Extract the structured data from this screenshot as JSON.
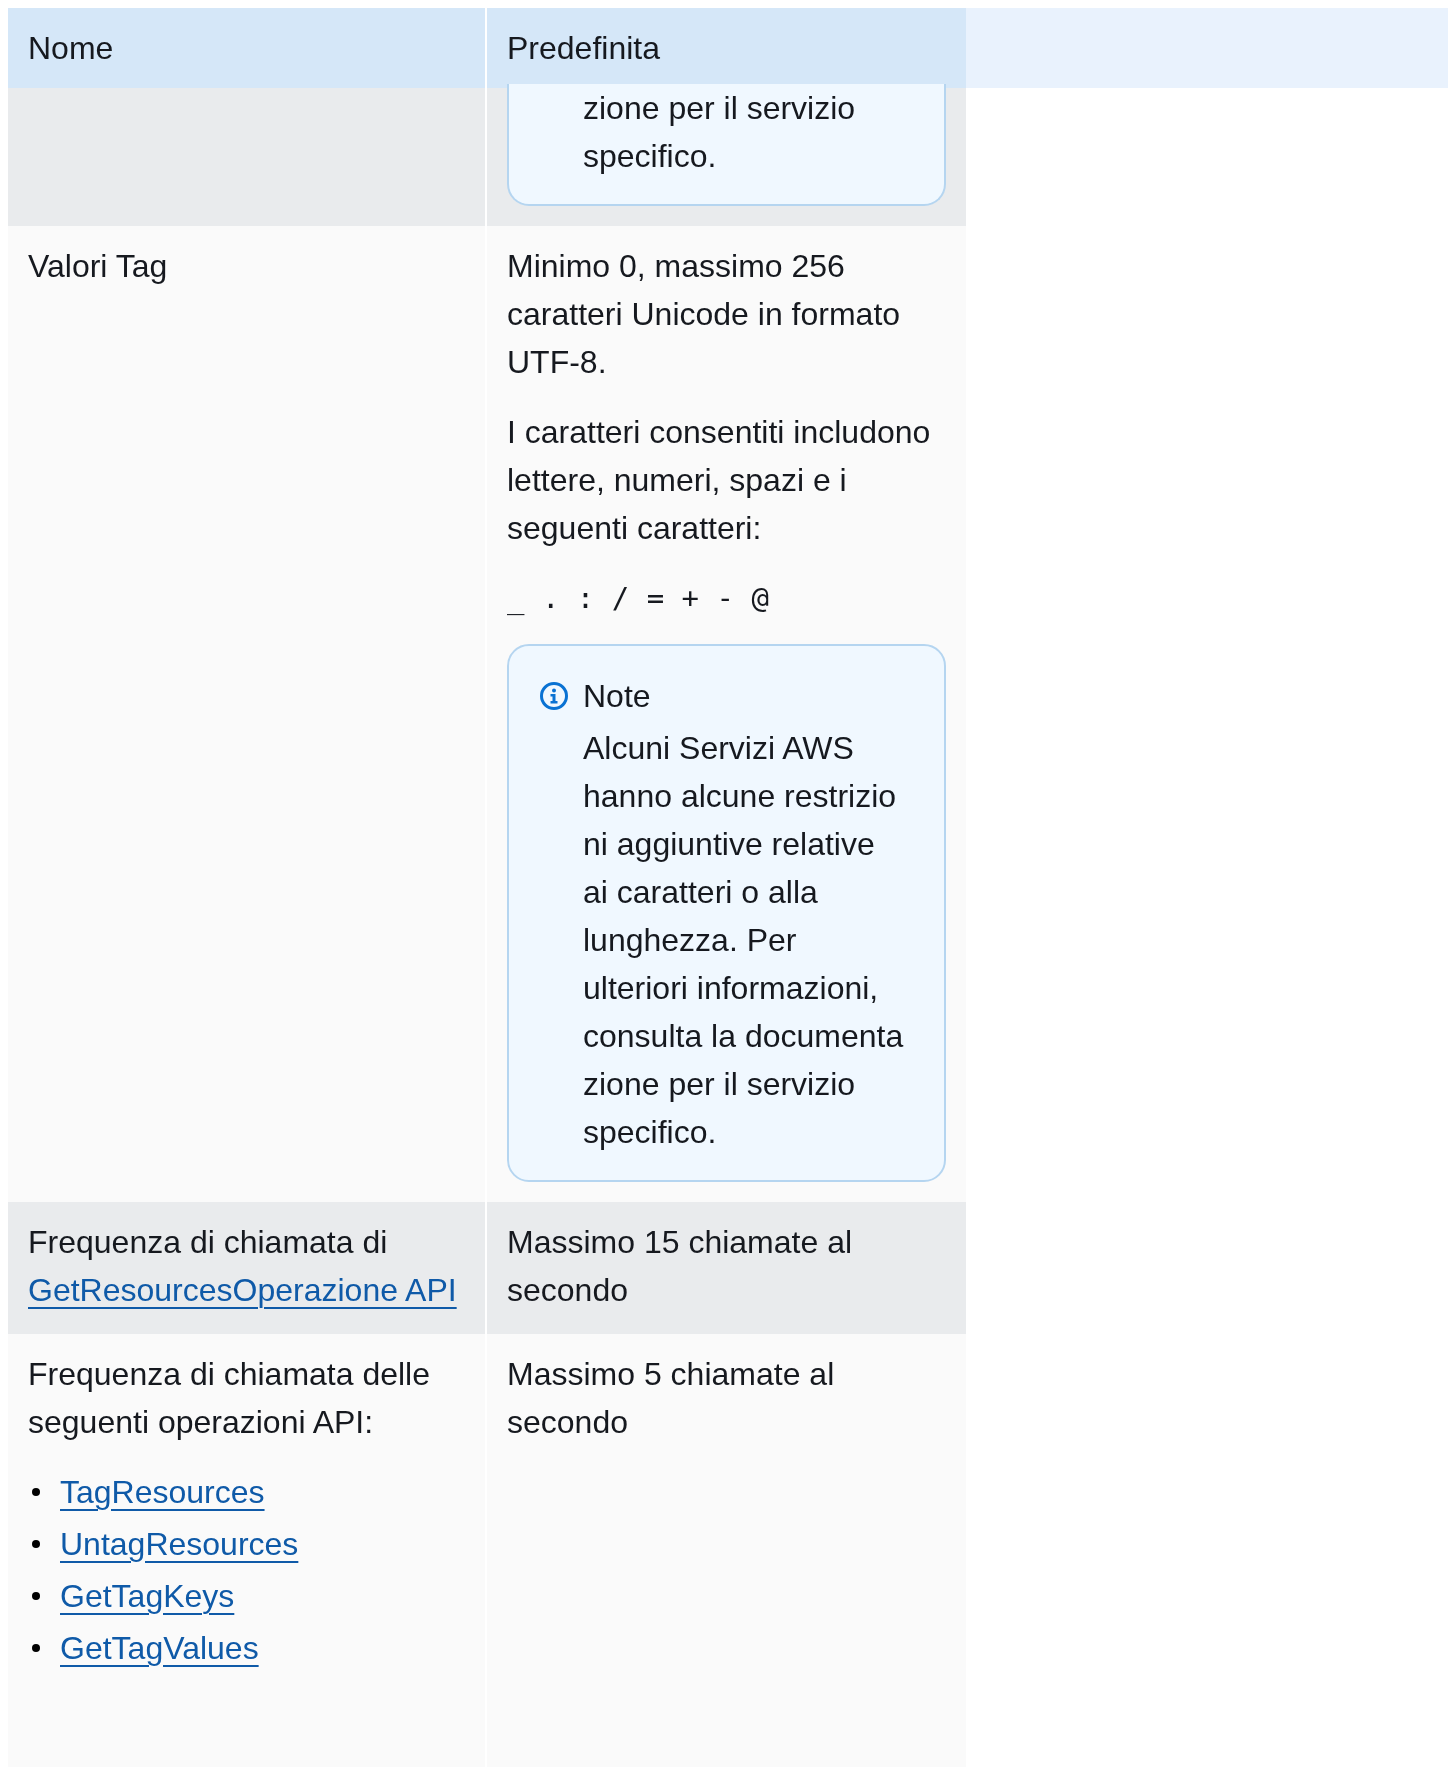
{
  "table": {
    "columns": [
      "Nome",
      "Predefinita"
    ],
    "rows": [
      {
        "name": [],
        "default": [
          {
            "kind": "note",
            "lines": [
              "zione per il servizio",
              "specifico."
            ]
          }
        ]
      },
      {
        "name": [
          {
            "kind": "text",
            "text": "Valori Tag"
          }
        ],
        "default": [
          {
            "kind": "text",
            "text": "Minimo 0, massimo 256 caratteri Unicode in formato UTF-8."
          },
          {
            "kind": "text",
            "text": "I caratteri consentiti includono lettere, numeri, spazi e i seguenti caratteri:"
          },
          {
            "kind": "code",
            "text": "_ . : / = + - @"
          },
          {
            "kind": "note",
            "title": "Note",
            "lines": [
              "Alcuni Servizi AWS",
              "hanno alcune restrizio",
              "ni aggiuntive relative",
              "ai caratteri o alla",
              "lunghezza. Per",
              "ulteriori informazioni,",
              "consulta la documenta",
              "zione per il servizio",
              "specifico."
            ]
          }
        ]
      },
      {
        "name": [
          {
            "kind": "text_link",
            "text": "Frequenza di chiamata di",
            "link": "GetResourcesOperazione API"
          }
        ],
        "default": [
          {
            "kind": "text",
            "text": "Massimo 15 chiamate al secondo"
          }
        ]
      },
      {
        "name": [
          {
            "kind": "text",
            "text": "Frequenza di chiamata delle seguenti operazioni API:"
          },
          {
            "kind": "links",
            "items": [
              "TagResources",
              "UntagResources",
              "GetTagKeys",
              "GetTagValues"
            ]
          }
        ],
        "default": [
          {
            "kind": "text",
            "text": "Massimo 5 chiamate al secondo"
          }
        ]
      }
    ]
  }
}
